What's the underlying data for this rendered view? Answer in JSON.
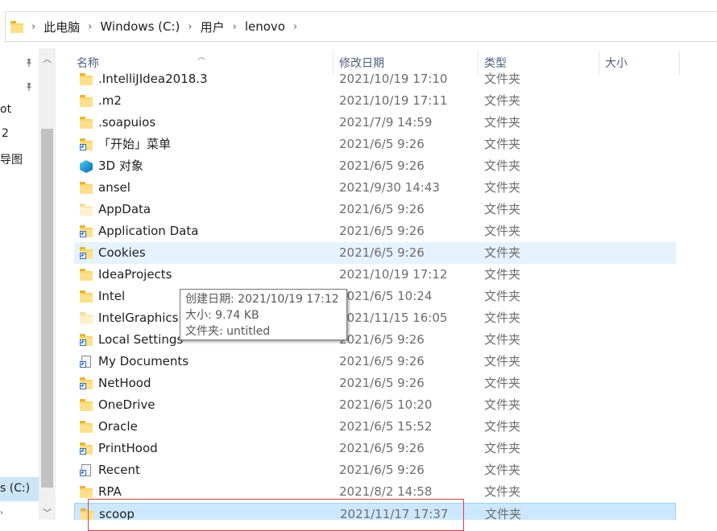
{
  "address_bar": {
    "breadcrumbs": [
      "此电脑",
      "Windows (C:)",
      "用户",
      "lenovo"
    ]
  },
  "nav_pane": {
    "items": [
      "ot",
      "2",
      "导图",
      "s (C:)"
    ]
  },
  "columns": {
    "name": "名称",
    "date": "修改日期",
    "type": "类型",
    "size": "大小"
  },
  "files": [
    {
      "name": ".IntelliJIdea2018.3",
      "date": "2021/10/19 17:10",
      "type": "文件夹",
      "icon": "folder-icon"
    },
    {
      "name": ".m2",
      "date": "2021/10/19 17:11",
      "type": "文件夹",
      "icon": "folder-icon"
    },
    {
      "name": ".soapuios",
      "date": "2021/7/9 14:59",
      "type": "文件夹",
      "icon": "folder-icon"
    },
    {
      "name": "「开始」菜单",
      "date": "2021/6/5 9:26",
      "type": "文件夹",
      "icon": "shortcut-folder-icon"
    },
    {
      "name": "3D 对象",
      "date": "2021/6/5 9:26",
      "type": "文件夹",
      "icon": "3d-objects-icon"
    },
    {
      "name": "ansel",
      "date": "2021/9/30 14:43",
      "type": "文件夹",
      "icon": "folder-icon"
    },
    {
      "name": "AppData",
      "date": "2021/6/5 9:26",
      "type": "文件夹",
      "icon": "hidden-folder-icon"
    },
    {
      "name": "Application Data",
      "date": "2021/6/5 9:26",
      "type": "文件夹",
      "icon": "shortcut-folder-icon"
    },
    {
      "name": "Cookies",
      "date": "2021/6/5 9:26",
      "type": "文件夹",
      "icon": "shortcut-folder-icon"
    },
    {
      "name": "IdeaProjects",
      "date": "2021/10/19 17:12",
      "type": "文件夹",
      "icon": "folder-icon"
    },
    {
      "name": "Intel",
      "date": "2021/6/5 10:24",
      "type": "文件夹",
      "icon": "folder-icon"
    },
    {
      "name": "IntelGraphicsP",
      "date": "2021/11/15 16:05",
      "type": "文件夹",
      "icon": "hidden-folder-icon"
    },
    {
      "name": "Local Settings",
      "date": "2021/6/5 9:26",
      "type": "文件夹",
      "icon": "shortcut-folder-icon"
    },
    {
      "name": "My Documents",
      "date": "2021/6/5 9:26",
      "type": "文件夹",
      "icon": "shortcut-document-icon"
    },
    {
      "name": "NetHood",
      "date": "2021/6/5 9:26",
      "type": "文件夹",
      "icon": "shortcut-folder-icon"
    },
    {
      "name": "OneDrive",
      "date": "2021/6/5 10:20",
      "type": "文件夹",
      "icon": "folder-icon"
    },
    {
      "name": "Oracle",
      "date": "2021/6/5 15:52",
      "type": "文件夹",
      "icon": "folder-icon"
    },
    {
      "name": "PrintHood",
      "date": "2021/6/5 9:26",
      "type": "文件夹",
      "icon": "shortcut-folder-icon"
    },
    {
      "name": "Recent",
      "date": "2021/6/5 9:26",
      "type": "文件夹",
      "icon": "shortcut-document-icon"
    },
    {
      "name": "RPA",
      "date": "2021/8/2 14:58",
      "type": "文件夹",
      "icon": "folder-icon"
    },
    {
      "name": "scoop",
      "date": "2021/11/17 17:37",
      "type": "文件夹",
      "icon": "folder-icon"
    }
  ],
  "tooltip": {
    "created": "创建日期: 2021/10/19 17:12",
    "size": "大小: 9.74 KB",
    "folder": "文件夹: untitled"
  },
  "colors": {
    "hover_row": "#e5f3ff",
    "selected_row": "#cce8ff",
    "header_text": "#4c607a",
    "annotation_red": "#e04040"
  }
}
